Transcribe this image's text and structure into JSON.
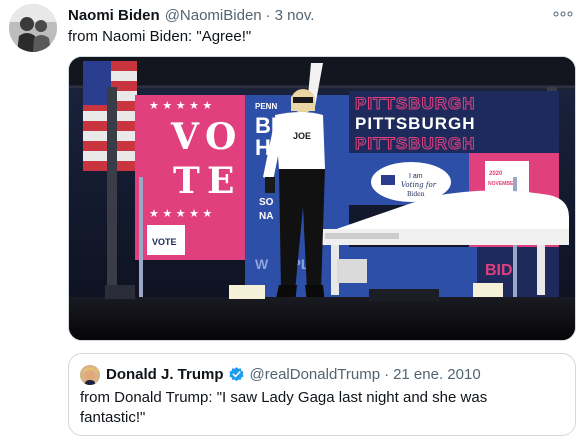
{
  "tweet": {
    "author_name": "Naomi Biden",
    "author_handle": "@NaomiBiden",
    "separator": "·",
    "timestamp": "3 nov.",
    "text": "from Naomi Biden: \"Agree!\"",
    "more_icon": "ellipsis-icon",
    "media": {
      "banner_line": "PITTSBURGH",
      "vote_letters": [
        "V",
        "O",
        "T",
        "E"
      ],
      "shirt_text": "JOE",
      "button_top": "I am",
      "button_mid": "Voting for",
      "button_bottom": "Biden",
      "sign_lines": [
        "PENN",
        "BI",
        "HE",
        "SO",
        "NA"
      ],
      "ground_text": "W      PLE",
      "right_sign_text": "BID",
      "ballot_text": "VOTE",
      "calendar_text": "NOVEMBER",
      "calendar_year": "2020",
      "colors": {
        "stage_dark": "#0c0d14",
        "pink": "#e0407d",
        "navy": "#1f2a5c",
        "blue": "#2e4fa8"
      }
    }
  },
  "quote": {
    "author_name": "Donald J. Trump",
    "verified_icon": "verified-badge-icon",
    "author_handle": "@realDonaldTrump",
    "separator": "·",
    "timestamp": "21 ene. 2010",
    "text": "from Donald Trump: \"I saw Lady Gaga last night and she was fantastic!\""
  },
  "colors": {
    "text_primary": "#0f1419",
    "text_secondary": "#536471",
    "border": "#cfd9de",
    "verified_blue": "#1d9bf0"
  }
}
